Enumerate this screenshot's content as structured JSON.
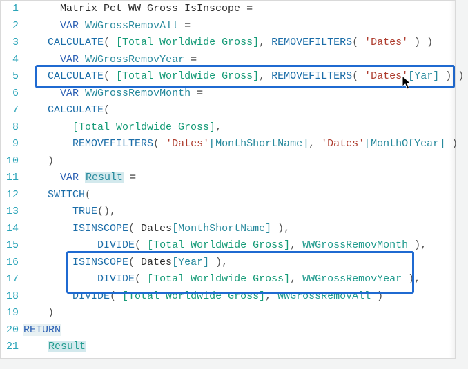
{
  "measure_name": "Matrix Pct WW Gross IsInscope",
  "keywords": {
    "var": "VAR",
    "return": "RETURN"
  },
  "vars": {
    "removAll": "WWGrossRemovAll",
    "removYear": "WWGrossRemovYear",
    "removMonth": "WWGrossRemovMonth",
    "result": "Result"
  },
  "funcs": {
    "calculate": "CALCULATE",
    "removefilters": "REMOVEFILTERS",
    "switch": "SWITCH",
    "true": "TRUE",
    "isinscope": "ISINSCOPE",
    "divide": "DIVIDE"
  },
  "refs": {
    "measure_total": "[Total Worldwide Gross]",
    "table_dates_q": "'Dates'",
    "table_dates": "Dates",
    "col_year_br": "[Year]",
    "col_year_partial": "ar]",
    "col_month_short": "[MonthShortName]",
    "col_month_of_year": "[MonthOfYear]"
  },
  "punct": {
    "eq": " =",
    "op": "(",
    "cl": ")",
    "comma_sp": ", ",
    "comma": ",",
    "sp": " ",
    "osp": "( ",
    "csp": " )",
    "ccsp": " ) )",
    "opcl": "()",
    "cl_comma": " ),"
  },
  "line_numbers": [
    "1",
    "2",
    "3",
    "4",
    "5",
    "6",
    "7",
    "8",
    "9",
    "10",
    "11",
    "12",
    "13",
    "14",
    "15",
    "16",
    "17",
    "18",
    "19",
    "20",
    "21"
  ],
  "chart_data": null
}
